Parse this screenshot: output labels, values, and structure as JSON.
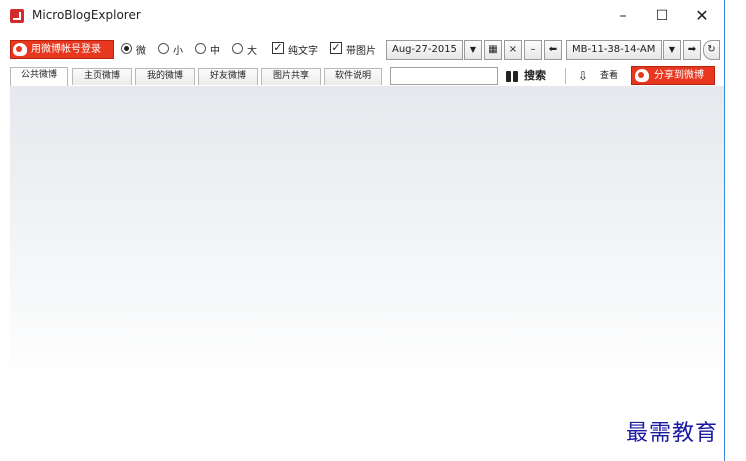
{
  "window": {
    "title": "MicroBlogExplorer",
    "controls": {
      "minimize": "–",
      "maximize": "☐",
      "close": "✕"
    }
  },
  "toolbar": {
    "login_label": "用微博帐号登录",
    "size_options": [
      {
        "label": "微",
        "selected": true
      },
      {
        "label": "小",
        "selected": false
      },
      {
        "label": "中",
        "selected": false
      },
      {
        "label": "大",
        "selected": false
      }
    ],
    "checkboxes": [
      {
        "label": "纯文字",
        "checked": true
      },
      {
        "label": "带图片",
        "checked": true
      }
    ],
    "date_value": "Aug-27-2015",
    "time_value": "MB-11-38-14-AM"
  },
  "tabs": [
    {
      "label": "公共微博",
      "active": true
    },
    {
      "label": "主页微博",
      "active": false
    },
    {
      "label": "我的微博",
      "active": false
    },
    {
      "label": "好友微博",
      "active": false
    },
    {
      "label": "图片共享",
      "active": false
    },
    {
      "label": "软件说明",
      "active": false
    }
  ],
  "search": {
    "value": "",
    "button_label": "搜索"
  },
  "view_label": "查看",
  "share_label": "分享到微博",
  "watermark": "最需教育",
  "colors": {
    "accent": "#e8371f",
    "border": "#3c8cd7"
  }
}
